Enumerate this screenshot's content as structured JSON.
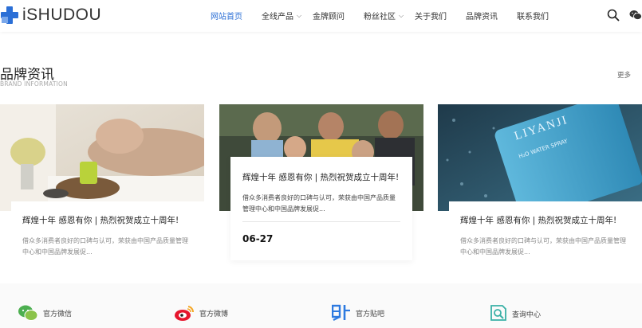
{
  "brand": {
    "logo_text": "iSHUDOU",
    "accent_color": "#2b6fd6"
  },
  "nav": {
    "items": [
      {
        "label": "网站首页",
        "active": true,
        "has_dropdown": false
      },
      {
        "label": "全线产品",
        "active": false,
        "has_dropdown": true
      },
      {
        "label": "金牌顾问",
        "active": false,
        "has_dropdown": false
      },
      {
        "label": "粉丝社区",
        "active": false,
        "has_dropdown": true
      },
      {
        "label": "关于我们",
        "active": false,
        "has_dropdown": false
      },
      {
        "label": "品牌资讯",
        "active": false,
        "has_dropdown": false
      },
      {
        "label": "联系我们",
        "active": false,
        "has_dropdown": false
      }
    ],
    "icons": [
      "search-icon",
      "wechat-icon"
    ]
  },
  "section": {
    "title": "品牌资讯",
    "subtitle": "BRAND INFORMATION",
    "more_label": "更多"
  },
  "cards": [
    {
      "title": "辉煌十年 感恩有你 | 热烈祝贺成立十周年!",
      "desc": "借众多消费者良好的口碑与认可，荣获由中国产品质量管理中心和中国品牌发展促...",
      "image": "spa-massage-photo"
    },
    {
      "title": "辉煌十年 感恩有你 | 热烈祝贺成立十周年!",
      "desc": "借众多消费者良好的口碑与认可，荣获由中国产品质量管理中心和中国品牌发展促...",
      "date": "06-27",
      "image": "team-meeting-photo"
    },
    {
      "title": "辉煌十年 感恩有你 | 热烈祝贺成立十周年!",
      "desc": "借众多消费者良好的口碑与认可，荣获由中国产品质量管理中心和中国品牌发展促...",
      "image": "water-spray-bottle-photo",
      "product_label": "LIYANJI",
      "product_sub": "H₂O WATER SPRAY"
    }
  ],
  "footer": {
    "items": [
      {
        "label": "官方微信",
        "icon": "wechat-icon"
      },
      {
        "label": "官方微博",
        "icon": "weibo-icon"
      },
      {
        "label": "官方贴吧",
        "icon": "tieba-icon"
      },
      {
        "label": "查询中心",
        "icon": "query-icon"
      }
    ]
  }
}
